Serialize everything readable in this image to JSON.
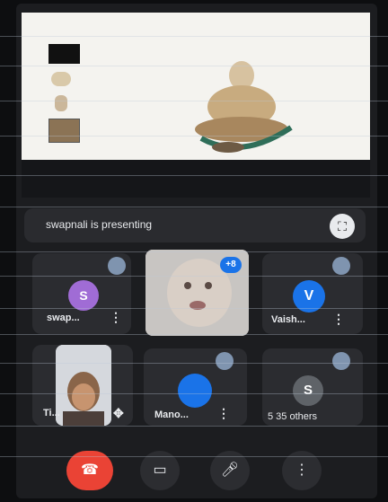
{
  "presentation": {
    "status_text": "swapnali is presenting",
    "fullscreen_icon": "fullscreen-icon"
  },
  "participants": [
    {
      "initial": "S",
      "name": "swap...",
      "color": "#a06cd5",
      "muted": true
    },
    {
      "initial": "",
      "name": "",
      "video": true,
      "badge": "+8"
    },
    {
      "initial": "V",
      "name": "Vaish...",
      "color": "#1a73e8",
      "muted": true
    },
    {
      "initial": "",
      "name": "Ti...",
      "video": true,
      "muted": false
    },
    {
      "initial": "",
      "name": "Mano...",
      "color": "#1a73e8",
      "muted": true
    },
    {
      "initial": "S",
      "name": "5 35 others",
      "color": "#5f6368",
      "muted": true
    }
  ],
  "controls": {
    "end_call": "end-call-icon",
    "camera": "camera-icon",
    "mic": "mic-icon",
    "more": "more-icon"
  },
  "colors": {
    "background": "#1c1d20",
    "end_call": "#ea4335",
    "accent": "#1a73e8"
  }
}
